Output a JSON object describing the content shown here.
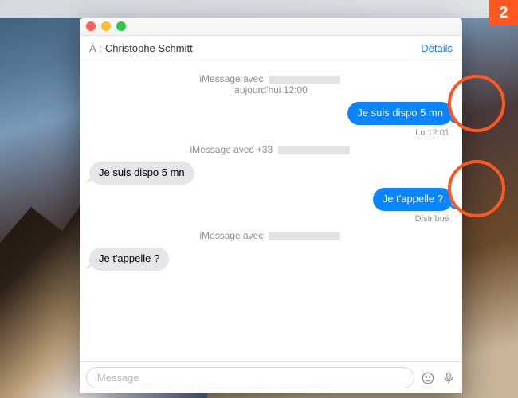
{
  "badge": "2",
  "colors": {
    "accent": "#0a84ff",
    "annotation": "#ff5722",
    "close": "#ff5f57",
    "min": "#febc2e",
    "max": "#28c840"
  },
  "header": {
    "to_label": "À :",
    "recipient": "Christophe Schmitt",
    "details": "Détails"
  },
  "conversation": [
    {
      "kind": "separator",
      "prefix": "iMessage avec",
      "meta": "aujourd'hui 12:00"
    },
    {
      "kind": "sent",
      "text": "Je suis dispo 5 mn"
    },
    {
      "kind": "status",
      "text": "Lu 12:01"
    },
    {
      "kind": "separator",
      "prefix": "iMessage avec +33",
      "meta": ""
    },
    {
      "kind": "recv",
      "text": "Je suis dispo 5 mn"
    },
    {
      "kind": "sent",
      "text": "Je t'appelle ?"
    },
    {
      "kind": "status",
      "text": "Distribué"
    },
    {
      "kind": "separator",
      "prefix": "iMessage avec",
      "meta": ""
    },
    {
      "kind": "recv",
      "text": "Je t'appelle ?"
    }
  ],
  "input": {
    "placeholder": "iMessage"
  }
}
